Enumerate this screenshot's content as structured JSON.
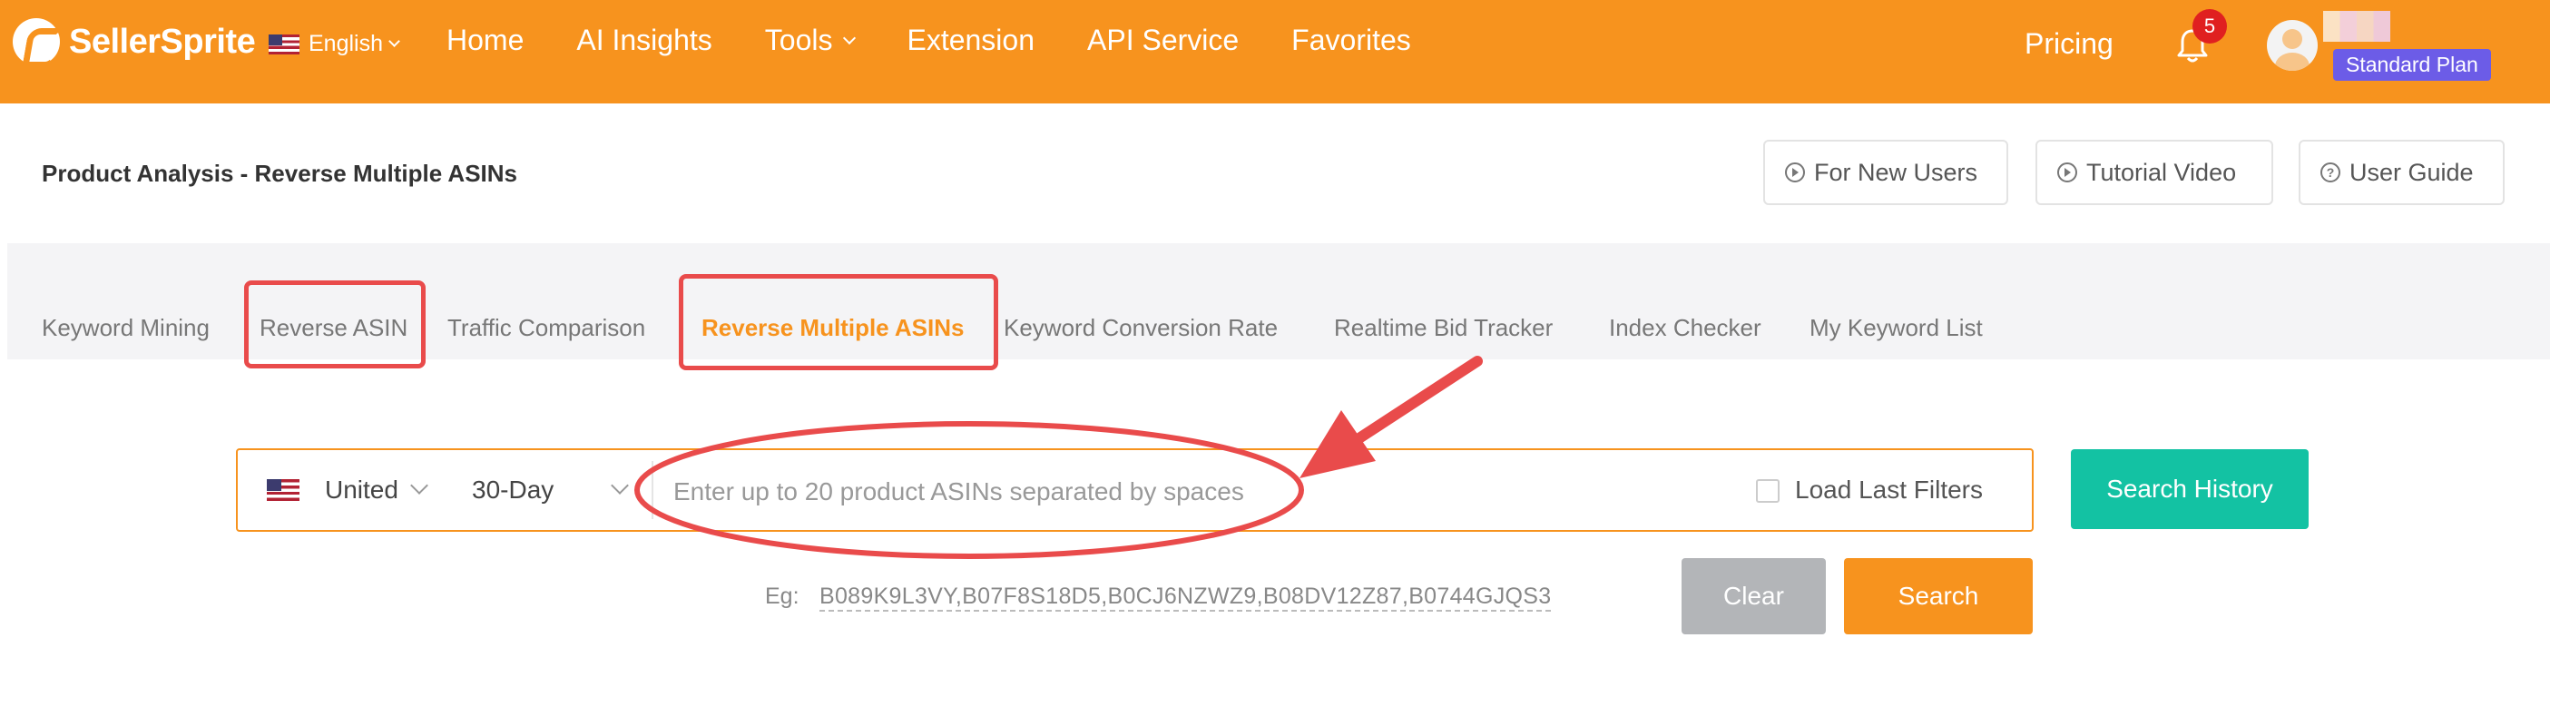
{
  "header": {
    "brand": "SellerSprite",
    "language": "English",
    "nav": [
      "Home",
      "AI Insights",
      "Tools",
      "Extension",
      "API Service",
      "Favorites"
    ],
    "pricing": "Pricing",
    "notifications_count": "5",
    "plan": "Standard Plan"
  },
  "page": {
    "title": "Product Analysis - Reverse Multiple ASINs",
    "help_buttons": [
      "For New Users",
      "Tutorial Video",
      "User Guide"
    ]
  },
  "tabs": [
    "Keyword Mining",
    "Reverse ASIN",
    "Traffic Comparison",
    "Reverse Multiple ASINs",
    "Keyword Conversion Rate",
    "Realtime Bid Tracker",
    "Index Checker",
    "My Keyword List"
  ],
  "active_tab": "Reverse Multiple ASINs",
  "search": {
    "marketplace": "United",
    "period": "30-Day",
    "placeholder": "Enter up to 20 product ASINs separated by spaces",
    "load_last_filters": "Load Last Filters",
    "history_button": "Search History",
    "clear_button": "Clear",
    "search_button": "Search",
    "example_label": "Eg:",
    "example_value": "B089K9L3VY,B07F8S18D5,B0CJ6NZWZ9,B08DV12Z87,B0744GJQS3"
  },
  "colors": {
    "brand_orange": "#F7931E",
    "teal": "#13C2A3",
    "annotation_red": "#E94B4B",
    "plan_badge": "#6C5CE7"
  }
}
